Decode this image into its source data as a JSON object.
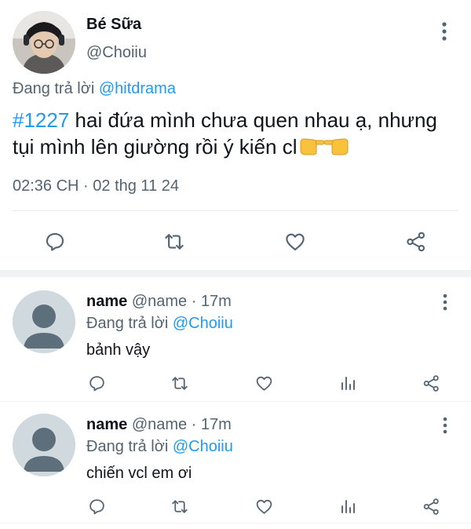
{
  "tweet": {
    "author_name": "Bé Sữa",
    "author_handle": "@Choiiu",
    "replying_prefix": "Đang trả lời ",
    "replying_to": "@hitdrama",
    "hashtag": "#1227",
    "text_after_hashtag": " hai đứa mình chưa quen nhau ạ, nhưng tụi mình lên giường rồi ý kiến cl",
    "timestamp": "02:36 CH · 02 thg 11 24",
    "emoji": "👉👈",
    "icons": [
      "reply-icon",
      "retweet-icon",
      "like-icon",
      "share-icon",
      "more-options-icon"
    ]
  },
  "replies": [
    {
      "name": "name",
      "handle": "@name",
      "separator": " · ",
      "time": "17m",
      "replying_prefix": "Đang trả lời ",
      "replying_to": "@Choiiu",
      "text": "bảnh vậy"
    },
    {
      "name": "name",
      "handle": "@name",
      "separator": " · ",
      "time": "17m",
      "replying_prefix": "Đang trả lời ",
      "replying_to": "@Choiiu",
      "text": "chiến vcl em ơi"
    }
  ],
  "colors": {
    "link": "#1d9bf0",
    "muted": "#536471",
    "icon": "#536471",
    "separator": "#eff3f4",
    "avatar_placeholder": "#cfd9de"
  }
}
